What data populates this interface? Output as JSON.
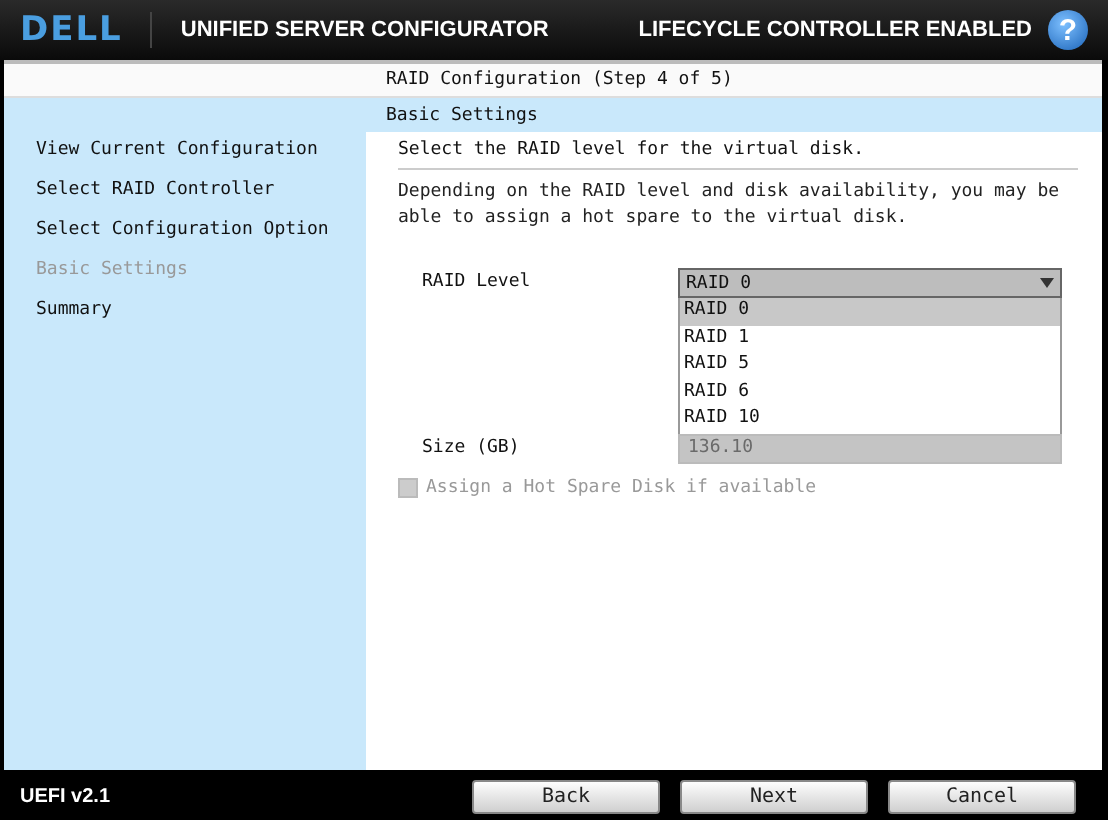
{
  "header": {
    "logo": "DELL",
    "title": "UNIFIED SERVER CONFIGURATOR",
    "status": "LIFECYCLE CONTROLLER ENABLED",
    "help": "?"
  },
  "page": {
    "title": "RAID Configuration (Step 4 of 5)",
    "subtitle": "Basic Settings"
  },
  "sidebar": {
    "items": [
      {
        "label": "View Current Configuration",
        "current": false
      },
      {
        "label": "Select RAID Controller",
        "current": false
      },
      {
        "label": "Select Configuration Option",
        "current": false
      },
      {
        "label": "Basic Settings",
        "current": true
      },
      {
        "label": "Summary",
        "current": false
      }
    ]
  },
  "content": {
    "instruction": "Select the RAID level for the virtual disk.",
    "description": "Depending on the RAID level and disk availability, you may be able to assign a hot spare to the virtual disk.",
    "raid_level": {
      "label": "RAID Level",
      "value": "RAID 0",
      "expanded": true,
      "options": [
        {
          "label": "RAID 0",
          "selected": true
        },
        {
          "label": "RAID 1",
          "selected": false
        },
        {
          "label": "RAID 5",
          "selected": false
        },
        {
          "label": "RAID 6",
          "selected": false
        },
        {
          "label": "RAID 10",
          "selected": false
        }
      ]
    },
    "size": {
      "label": "Size (GB)",
      "value": "136.10",
      "disabled": true
    },
    "hot_spare": {
      "label": "Assign a Hot Spare Disk if available",
      "checked": false,
      "disabled": true
    }
  },
  "footer": {
    "version": "UEFI v2.1",
    "buttons": [
      "Back",
      "Next",
      "Cancel"
    ]
  }
}
